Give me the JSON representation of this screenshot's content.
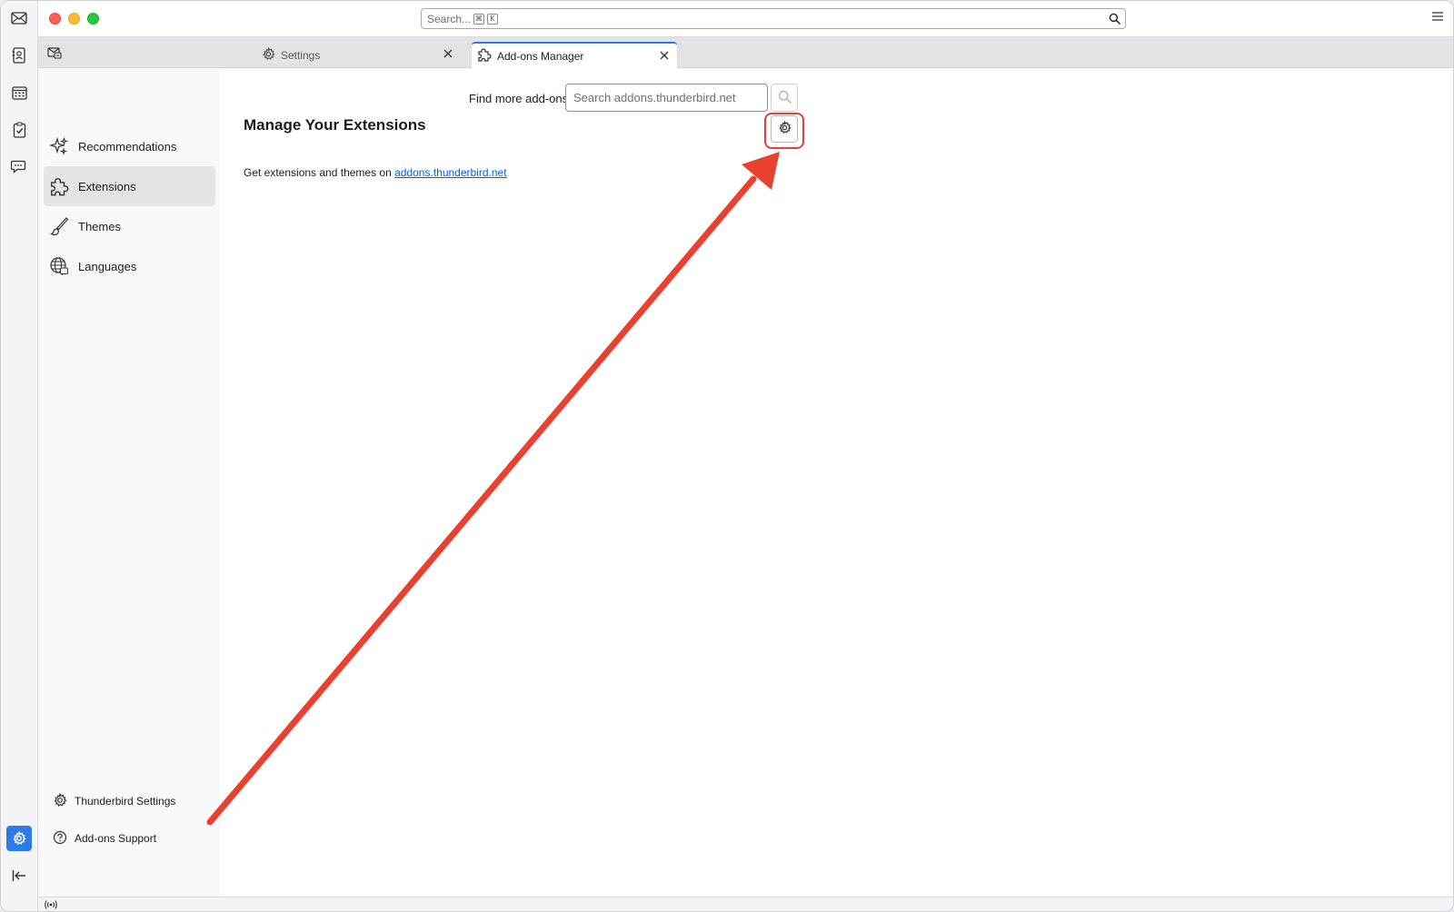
{
  "titlebar": {
    "search_placeholder": "Search...",
    "shortcut_keys": [
      "⌘",
      "K"
    ]
  },
  "spaces": {
    "items": [
      {
        "name": "mail",
        "icon": "mail-icon"
      },
      {
        "name": "address-book",
        "icon": "address-book-icon"
      },
      {
        "name": "calendar",
        "icon": "calendar-icon"
      },
      {
        "name": "tasks",
        "icon": "tasks-icon"
      },
      {
        "name": "chat",
        "icon": "chat-icon"
      }
    ],
    "bottom": [
      {
        "name": "settings",
        "icon": "gear-icon",
        "active": true
      },
      {
        "name": "collapse",
        "icon": "collapse-icon"
      }
    ]
  },
  "tabs": [
    {
      "label": "Settings",
      "icon": "gear-icon"
    },
    {
      "label": "Add-ons Manager",
      "icon": "puzzle-icon",
      "active": true
    }
  ],
  "sidebar": {
    "categories": [
      {
        "label": "Recommendations",
        "icon": "sparkle-icon"
      },
      {
        "label": "Extensions",
        "icon": "puzzle-icon",
        "selected": true
      },
      {
        "label": "Themes",
        "icon": "brush-icon"
      },
      {
        "label": "Languages",
        "icon": "globe-icon"
      }
    ],
    "footer": [
      {
        "label": "Thunderbird Settings",
        "icon": "gear-icon"
      },
      {
        "label": "Add-ons Support",
        "icon": "help-icon"
      }
    ]
  },
  "main": {
    "find_label": "Find more add-ons",
    "find_placeholder": "Search addons.thunderbird.net",
    "heading": "Manage Your Extensions",
    "info_text": "Get extensions and themes on ",
    "info_link": "addons.thunderbird.net"
  },
  "colors": {
    "accent": "#2d7be8",
    "annotation": "#e8412f",
    "link": "#0060df"
  }
}
